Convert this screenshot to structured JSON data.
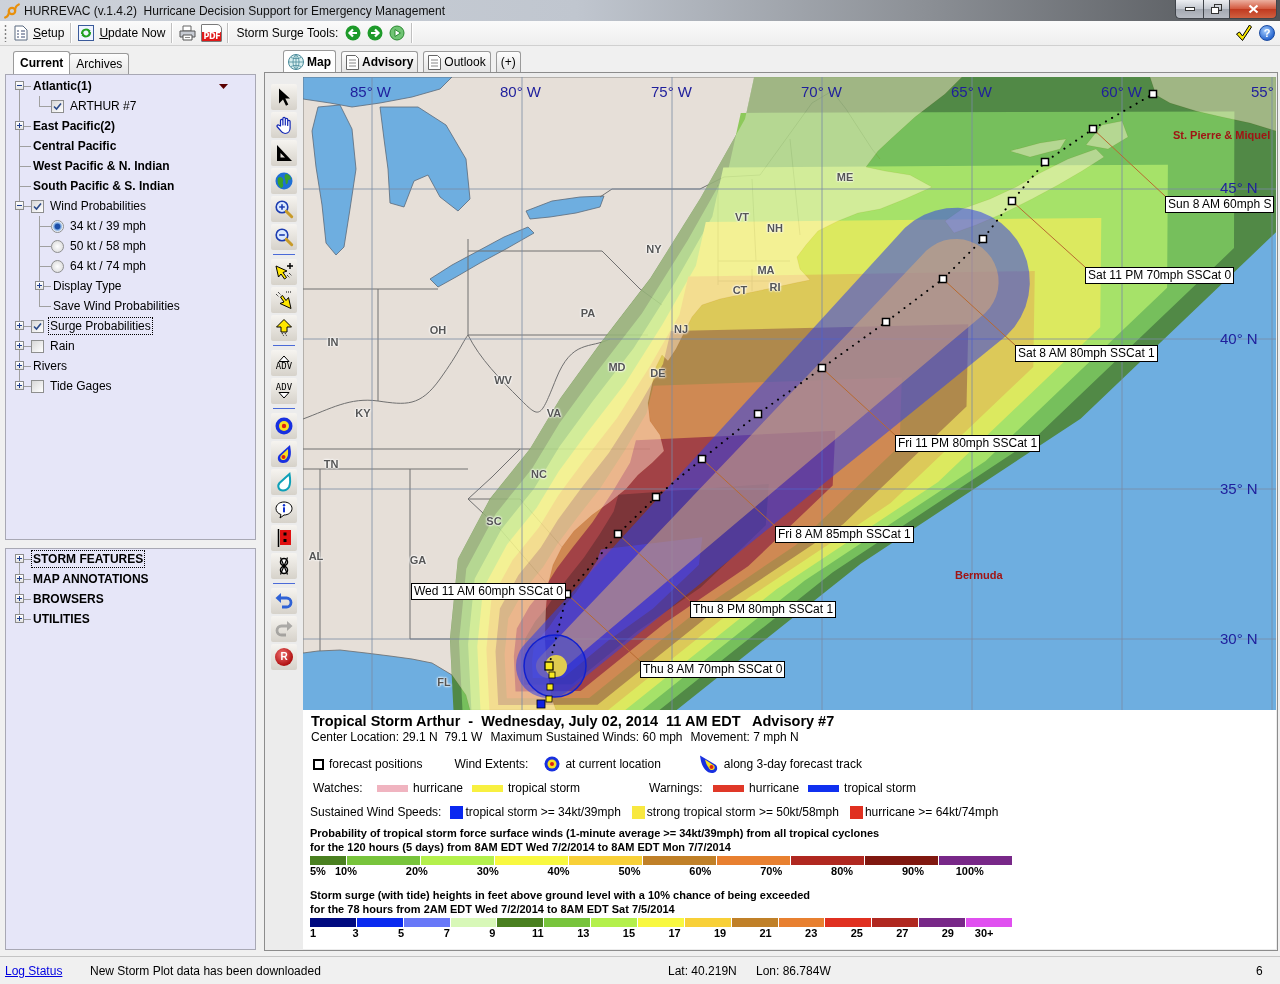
{
  "window": {
    "title": "HURREVAC (v.1.4.2)  Hurricane Decision Support for Emergency Management"
  },
  "toolbar": {
    "setup": "Setup",
    "update": "Update Now",
    "pdf": "PDF",
    "surge_tools": "Storm Surge Tools:",
    "help": "?"
  },
  "side_tabs": [
    {
      "label": "Current",
      "selected": true
    },
    {
      "label": "Archives",
      "selected": false
    }
  ],
  "tree": [
    {
      "label": "Atlantic(1)",
      "kind": "basin",
      "expanded": true,
      "focused": false,
      "menu": true,
      "children": [
        {
          "label": "ARTHUR #7",
          "kind": "storm",
          "checked": true
        }
      ]
    },
    {
      "label": "East Pacific(2)",
      "kind": "basin",
      "expanded": false,
      "focused": false
    },
    {
      "label": "Central Pacific",
      "kind": "basin",
      "focused": false
    },
    {
      "label": "West Pacific & N. Indian",
      "kind": "basin",
      "focused": false
    },
    {
      "label": "South Pacific & S. Indian",
      "kind": "basin",
      "focused": false
    },
    {
      "label": "Wind Probabilities",
      "kind": "layer",
      "expanded": true,
      "checked": true,
      "focused": false,
      "children": [
        {
          "label": "34 kt / 39 mph",
          "kind": "option",
          "selected": true
        },
        {
          "label": "50 kt / 58 mph",
          "kind": "option",
          "selected": false
        },
        {
          "label": "64 kt / 74 mph",
          "kind": "option",
          "selected": false
        },
        {
          "label": "Display Type",
          "kind": "folder",
          "expanded": false
        },
        {
          "label": "Save Wind Probabilities",
          "kind": "action"
        }
      ]
    },
    {
      "label": "Surge Probabilities",
      "kind": "layer",
      "expanded": false,
      "checked": true,
      "focused": true
    },
    {
      "label": "Rain",
      "kind": "layer",
      "expanded": false,
      "checked": false,
      "focused": false
    },
    {
      "label": "Rivers",
      "kind": "folder",
      "expanded": false,
      "focused": false
    },
    {
      "label": "Tide Gages",
      "kind": "layer",
      "expanded": false,
      "checked": false,
      "focused": false
    }
  ],
  "sections": [
    {
      "label": "STORM FEATURES",
      "expanded": false,
      "focused": true
    },
    {
      "label": "MAP ANNOTATIONS",
      "expanded": false,
      "focused": false
    },
    {
      "label": "BROWSERS",
      "expanded": false,
      "focused": false
    },
    {
      "label": "UTILITIES",
      "expanded": false,
      "focused": false
    }
  ],
  "map_tabs": [
    {
      "label": "Map",
      "kind": "map",
      "selected": true,
      "highlighted": true
    },
    {
      "label": "Advisory",
      "kind": "page",
      "selected": false,
      "highlighted": true
    },
    {
      "label": "Outlook",
      "kind": "page",
      "selected": false,
      "highlighted": false
    },
    {
      "label": "(+)",
      "kind": "new",
      "selected": false,
      "highlighted": false
    }
  ],
  "tool_groups": [
    [
      {
        "kind": "pointer",
        "disabled": false
      },
      {
        "kind": "pan",
        "disabled": false
      },
      {
        "kind": "measure",
        "disabled": false
      },
      {
        "kind": "globe",
        "disabled": false
      },
      {
        "kind": "zoom-in",
        "disabled": false
      },
      {
        "kind": "zoom-out",
        "disabled": false
      }
    ],
    [
      {
        "kind": "add-mark",
        "disabled": false
      },
      {
        "kind": "edit-mark",
        "disabled": false
      },
      {
        "kind": "move-mark",
        "disabled": false
      }
    ],
    [
      {
        "kind": "advisory-up",
        "label": "ADV",
        "disabled": false
      },
      {
        "kind": "advisory-down",
        "label": "ADV",
        "disabled": false
      }
    ],
    [
      {
        "kind": "wind-extent",
        "disabled": false
      },
      {
        "kind": "wind-swath",
        "disabled": false
      },
      {
        "kind": "cone",
        "disabled": false
      },
      {
        "kind": "info",
        "disabled": false
      },
      {
        "kind": "flag",
        "disabled": false
      },
      {
        "kind": "loop",
        "disabled": false
      }
    ],
    [
      {
        "kind": "undo",
        "disabled": false
      },
      {
        "kind": "redo",
        "disabled": true
      },
      {
        "kind": "record",
        "label": "R",
        "disabled": false
      }
    ]
  ],
  "map": {
    "longitudes": [
      "85° W",
      "80° W",
      "75° W",
      "70° W",
      "65° W",
      "60° W",
      "55°"
    ],
    "latitudes": [
      "45° N",
      "40° N",
      "35° N",
      "30° N"
    ],
    "states": [
      "IN",
      "OH",
      "PA",
      "NY",
      "KY",
      "WV",
      "VA",
      "TN",
      "NC",
      "SC",
      "AL",
      "GA",
      "FL",
      "VT",
      "NH",
      "ME",
      "MA",
      "CT",
      "RI",
      "NJ",
      "MD",
      "DE"
    ],
    "places": [
      "Bermuda",
      "St. Pierre & Miquel"
    ],
    "forecast_labels": [
      "Sun 8 AM 60mph S",
      "Sat 11 PM 70mph SSCat 0",
      "Sat 8 AM 80mph SSCat 1",
      "Fri 11 PM 80mph SSCat 1",
      "Fri 8 AM 85mph SSCat 1",
      "Thu 8 PM 80mph SSCat 1",
      "Thu 8 AM 70mph SSCat 0",
      "Wed 11 AM 60mph SSCat 0"
    ]
  },
  "advisory": {
    "title": "Tropical Storm Arthur  -  Wednesday, July 02, 2014  11 AM EDT   Advisory #7",
    "details": [
      "Center Location: 29.1 N  79.1 W",
      "Maximum Sustained Winds: 60 mph",
      "Movement: 7 mph N"
    ]
  },
  "legend": {
    "symbols": [
      {
        "kind": "forecast-position",
        "label": "forecast positions"
      },
      {
        "kind": "heading",
        "label": "Wind Extents:"
      },
      {
        "kind": "current-extent",
        "label": "at current location"
      },
      {
        "kind": "track-extent",
        "label": "along 3-day forecast track"
      }
    ],
    "watches": {
      "label": "Watches:",
      "items": [
        {
          "label": "hurricane",
          "color": "#f0b4c0"
        },
        {
          "label": "tropical storm",
          "color": "#f8f040"
        }
      ]
    },
    "warnings": {
      "label": "Warnings:",
      "items": [
        {
          "label": "hurricane",
          "color": "#e03828"
        },
        {
          "label": "tropical storm",
          "color": "#1030f0"
        }
      ]
    },
    "wind_speeds": {
      "label": "Sustained Wind Speeds:",
      "items": [
        {
          "label": "tropical storm >= 34kt/39mph",
          "color": "#0a28f0"
        },
        {
          "label": "strong tropical storm >= 50kt/58mph",
          "color": "#f8e840"
        },
        {
          "label": "hurricane >= 64kt/74mph",
          "color": "#e03020"
        }
      ]
    },
    "probability_scale": {
      "title": "Probability of tropical storm force surface winds (1-minute average >= 34kt/39mph) from all tropical cyclones",
      "subtitle": "for the 120 hours (5 days) from 8AM EDT Wed 7/2/2014 to 8AM EDT Mon 7/7/2014",
      "segments": [
        {
          "color": "#4a8020"
        },
        {
          "color": "#78c43c"
        },
        {
          "color": "#b4f04c"
        },
        {
          "color": "#f8f840"
        },
        {
          "color": "#f8d038"
        },
        {
          "color": "#c08028"
        },
        {
          "color": "#e88030"
        },
        {
          "color": "#b02820"
        },
        {
          "color": "#801810"
        },
        {
          "color": "#782888"
        }
      ],
      "ticks": [
        "5%",
        "10%",
        "20%",
        "30%",
        "40%",
        "50%",
        "60%",
        "70%",
        "80%",
        "90%",
        "100%"
      ]
    },
    "surge_scale": {
      "title": "Storm surge (with tide) heights in feet above ground level with a 10% chance of being exceeded",
      "subtitle": "for the 78 hours from 2AM EDT Wed 7/2/2014 to 8AM EDT Sat 7/5/2014",
      "segments": [
        {
          "color": "#000a80"
        },
        {
          "color": "#0a2af0"
        },
        {
          "color": "#6878f8"
        },
        {
          "color": "#d8f8b8"
        },
        {
          "color": "#4a8020"
        },
        {
          "color": "#78c43c"
        },
        {
          "color": "#b4f04c"
        },
        {
          "color": "#f8f840"
        },
        {
          "color": "#f8d038"
        },
        {
          "color": "#c08028"
        },
        {
          "color": "#e88030"
        },
        {
          "color": "#e03020"
        },
        {
          "color": "#b02820"
        },
        {
          "color": "#782888"
        },
        {
          "color": "#e050f0"
        }
      ],
      "ticks": [
        "1",
        "3",
        "5",
        "7",
        "9",
        "11",
        "13",
        "15",
        "17",
        "19",
        "21",
        "23",
        "25",
        "27",
        "29",
        "30+"
      ]
    }
  },
  "status_bar": {
    "link": "Log Status",
    "message": "New Storm Plot data has been downloaded",
    "latitude": "Lat: 40.219N",
    "longitude": "Lon: 86.784W",
    "count": "6"
  }
}
